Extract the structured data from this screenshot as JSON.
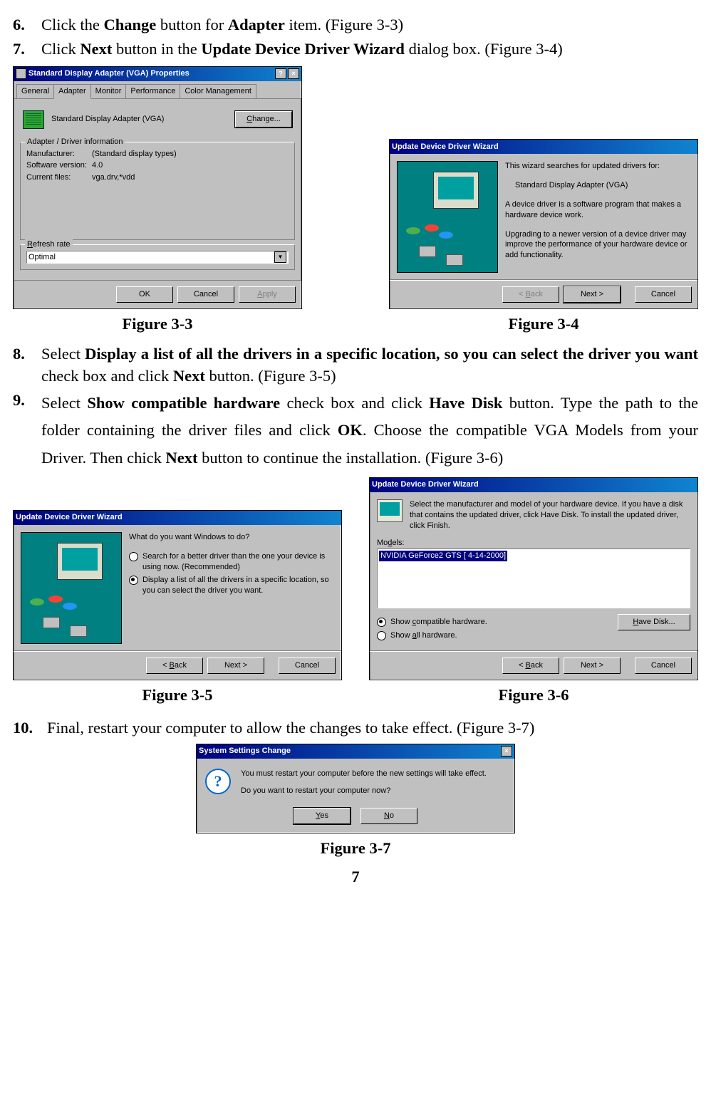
{
  "steps": {
    "s6": {
      "num": "6.",
      "t1": "Click the ",
      "b1": "Change",
      "t2": " button for ",
      "b2": "Adapter",
      "t3": " item. (Figure 3-3)"
    },
    "s7": {
      "num": "7.",
      "t1": "Click ",
      "b1": "Next",
      "t2": " button in the ",
      "b2": "Update Device Driver Wizard",
      "t3": " dialog box. (Figure 3-4)"
    },
    "s8": {
      "num": "8.",
      "t1": "Select ",
      "b1": "Display a list of all the drivers in a specific location, so you can select the driver you want",
      "t2": " check box and click ",
      "b2": "Next",
      "t3": " button. (Figure 3-5)"
    },
    "s9": {
      "num": "9.",
      "t1": "Select ",
      "b1": "Show compatible hardware",
      "t2": " check box and click ",
      "b2": "Have Disk",
      "t3": " button. Type the path to the folder containing the driver files and click ",
      "b3": "OK",
      "t4": ".  Choose the compatible VGA Models from your Driver.  Then chick ",
      "b4": "Next",
      "t5": " button to continue the installation. (Figure 3-6)"
    },
    "s10": {
      "num": "10.",
      "t1": "Final, restart your computer to allow the changes to take effect. (Figure 3-7)"
    }
  },
  "captions": {
    "f33": "Figure 3-3",
    "f34": "Figure 3-4",
    "f35": "Figure 3-5",
    "f36": "Figure 3-6",
    "f37": "Figure 3-7"
  },
  "fig33": {
    "title": "Standard Display Adapter (VGA) Properties",
    "tabs": {
      "general": "General",
      "adapter": "Adapter",
      "monitor": "Monitor",
      "performance": "Performance",
      "color": "Color Management"
    },
    "adapter_name": "Standard Display Adapter (VGA)",
    "change_btn": "Change...",
    "group1": "Adapter / Driver information",
    "manufacturer_l": "Manufacturer:",
    "manufacturer_v": "(Standard display types)",
    "softver_l": "Software version:",
    "softver_v": "4.0",
    "curfiles_l": "Current files:",
    "curfiles_v": "vga.drv,*vdd",
    "group2": "Refresh rate",
    "refresh_v": "Optimal",
    "ok": "OK",
    "cancel": "Cancel",
    "apply": "Apply",
    "refresh_u": "R"
  },
  "fig34": {
    "title": "Update Device Driver Wizard",
    "p1": "This wizard searches for updated drivers for:",
    "p2": "Standard Display Adapter (VGA)",
    "p3": "A device driver is a software program that makes a hardware device work.",
    "p4": "Upgrading to a newer version of a device driver may improve the performance of your hardware device or add functionality.",
    "back": "< Back",
    "next": "Next >",
    "cancel": "Cancel",
    "back_u": "B"
  },
  "fig35": {
    "title": "Update Device Driver Wizard",
    "q": "What do you want Windows to do?",
    "r1": "Search for a better driver than the one your device is using now. (Recommended)",
    "r2": "Display a list of all the drivers in a specific location, so you can select the driver you want.",
    "back": "< Back",
    "next": "Next >",
    "cancel": "Cancel",
    "back_u": "B"
  },
  "fig36": {
    "title": "Update Device Driver Wizard",
    "intro": "Select the manufacturer and model of your hardware device. If you have a disk that contains the updated driver, click Have Disk. To install the updated driver, click Finish.",
    "models_l": "Models:",
    "model_item": "NVIDIA GeForce2 GTS [ 4-14-2000]",
    "r1": "Show compatible hardware.",
    "r2": "Show all hardware.",
    "havedisk": "Have Disk...",
    "back": "< Back",
    "next": "Next >",
    "cancel": "Cancel",
    "models_u": "d",
    "r1_u": "c",
    "r2_u": "a",
    "back_u": "B",
    "hd_u": "H"
  },
  "fig37": {
    "title": "System Settings Change",
    "p1": "You must restart your computer before the new settings will take effect.",
    "p2": "Do you want to restart your computer now?",
    "yes": "Yes",
    "no": "No",
    "yes_u": "Y",
    "no_u": "N"
  },
  "page_number": "7"
}
